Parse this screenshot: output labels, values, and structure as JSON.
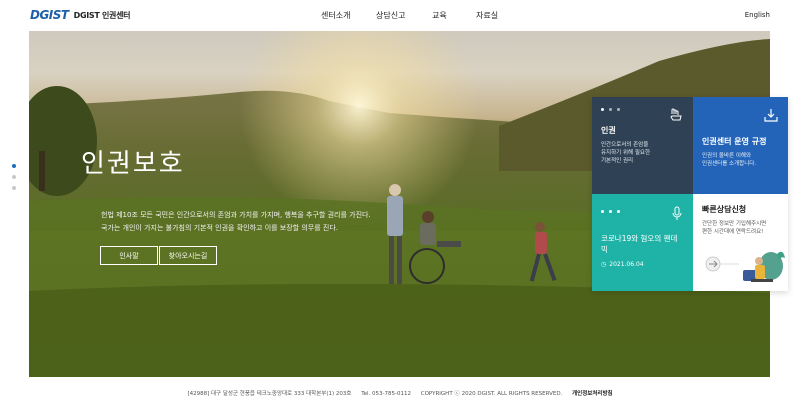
{
  "header": {
    "logo_mark": "DGIST",
    "logo_text": "DGIST 인권센터",
    "nav": [
      "센터소개",
      "상담신고",
      "교육",
      "자료실"
    ],
    "language": "English"
  },
  "hero": {
    "title": "인권보호",
    "text_line1": "헌법 제10조 모든 국민은 인간으로서의 존엄과 가치를 가지며, 행복을 추구할 권리를 가진다.",
    "text_line2": "국가는 개인이 가지는 불가침의 기본적 인권을 확인하고 이를 보장할 의무를 진다.",
    "button_greeting": "인사말",
    "button_directions": "찾아오시는길"
  },
  "panel": {
    "card1": {
      "title": "인권",
      "desc_lines": [
        "인간으로서의 존엄을",
        "유지하기 위해 필요한",
        "기본적인 권리"
      ]
    },
    "card2": {
      "title": "인권센터 운영 규정",
      "desc_lines": [
        "인권의 올바른 이해와",
        "인권센터를 소개합니다."
      ]
    },
    "card3": {
      "title_lines": [
        "코로나19와 혐오의 팬데",
        "믹"
      ],
      "date": "2021.06.04"
    },
    "card4": {
      "title": "빠른상담신청",
      "desc_lines": [
        "간단한 정보만 기입해주시면",
        "편한 시간대에 연락드려요!"
      ]
    }
  },
  "footer": {
    "address": "[42988] 대구 달성군 현풍읍 테크노중앙대로 333 대학본부(1) 203호",
    "tel": "Tel. 053-785-0112",
    "copyright": "COPYRIGHT ⓒ 2020 DGIST. ALL RIGHTS RESERVED.",
    "privacy": "개인정보처리방침"
  },
  "colors": {
    "brand_blue": "#1f5fa8",
    "card_dark": "#2f4255",
    "card_blue": "#2464b8",
    "card_teal": "#1fb3a8"
  }
}
